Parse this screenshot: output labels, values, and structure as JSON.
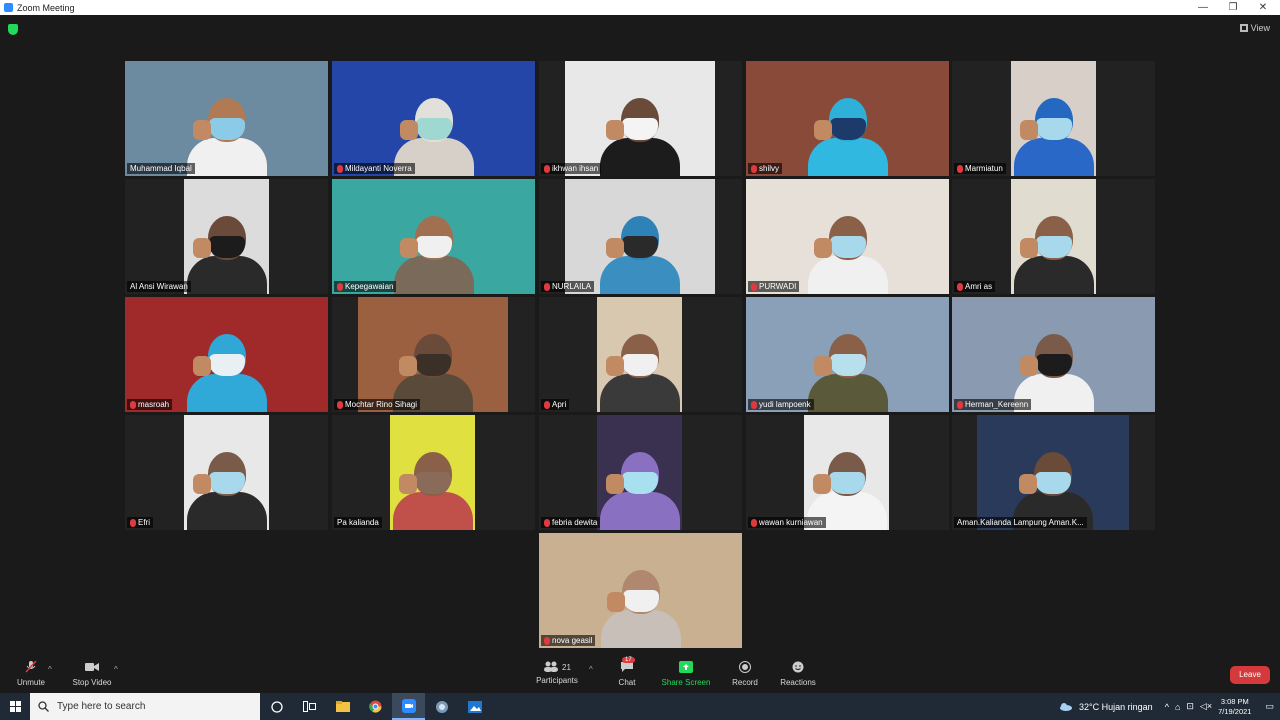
{
  "window": {
    "title": "Zoom Meeting",
    "controls": {
      "minimize": "—",
      "maximize": "❐",
      "close": "✕"
    }
  },
  "header": {
    "view_label": "View"
  },
  "participants": [
    {
      "name": "Muhammad Iqbal",
      "muted": false,
      "active": true,
      "bg": "#6c8aa0",
      "skin": "#b07a55",
      "mask": "#8ccbe8",
      "shirt": "#f0f0f0"
    },
    {
      "name": "Mildayanti Noverra",
      "muted": true,
      "active": false,
      "bg": "#2446a8",
      "skin": "#e2e0da",
      "mask": "#9fd8d0",
      "shirt": "#d6d0c8"
    },
    {
      "name": "ikhwan ihsan",
      "muted": true,
      "active": false,
      "bg": "#e8e8e8",
      "skin": "#6a4a38",
      "mask": "#f4f4f4",
      "shirt": "#1c1c1c"
    },
    {
      "name": "shilvy",
      "muted": true,
      "active": false,
      "bg": "#8a4a3a",
      "skin": "#2fb0d8",
      "mask": "#1d3b6a",
      "shirt": "#30b8e0"
    },
    {
      "name": "Marmiatun",
      "muted": true,
      "active": false,
      "bg": "#d8d0c8",
      "skin": "#2468c0",
      "mask": "#a8d8ec",
      "shirt": "#2a68c8"
    },
    {
      "name": "Al Ansi Wirawan",
      "muted": false,
      "active": false,
      "bg": "#dcdcdc",
      "skin": "#6a4a38",
      "mask": "#1c1c1c",
      "shirt": "#2a2a2a"
    },
    {
      "name": "Kepegawaian",
      "muted": true,
      "active": false,
      "bg": "#3aa8a0",
      "skin": "#a07050",
      "mask": "#f0f0f0",
      "shirt": "#7a6a5a"
    },
    {
      "name": "NURLAILA",
      "muted": true,
      "active": false,
      "bg": "#d8d8d8",
      "skin": "#2f82b8",
      "mask": "#2a2a2a",
      "shirt": "#3a8ec0"
    },
    {
      "name": "PURWADI",
      "muted": true,
      "active": false,
      "bg": "#e6e0d8",
      "skin": "#8a6048",
      "mask": "#a8d8ec",
      "shirt": "#f0f0f0"
    },
    {
      "name": "Amri as",
      "muted": true,
      "active": false,
      "bg": "#e0dcd0",
      "skin": "#8a6048",
      "mask": "#a8d8ec",
      "shirt": "#2a2a2a"
    },
    {
      "name": "masroah",
      "muted": true,
      "active": false,
      "bg": "#a02a2a",
      "skin": "#2fa8d8",
      "mask": "#e8f0f4",
      "shirt": "#30a8d8"
    },
    {
      "name": "Mochtar Rino Sihagi",
      "muted": true,
      "active": false,
      "bg": "#9a6040",
      "skin": "#6a4a38",
      "mask": "#3a3028",
      "shirt": "#5a4a3a"
    },
    {
      "name": "Apri",
      "muted": true,
      "active": false,
      "bg": "#d8c8b0",
      "skin": "#8a6048",
      "mask": "#f0f0f0",
      "shirt": "#3a3a3a"
    },
    {
      "name": "yudi lampoenk",
      "muted": true,
      "active": false,
      "bg": "#8aa0b8",
      "skin": "#8a6048",
      "mask": "#b8e0ec",
      "shirt": "#5a5a3a"
    },
    {
      "name": "Herman_Kereenn",
      "muted": true,
      "active": false,
      "bg": "#8a9ab0",
      "skin": "#7a5a48",
      "mask": "#1c1c1c",
      "shirt": "#f0f0f0"
    },
    {
      "name": "Efri",
      "muted": true,
      "active": false,
      "bg": "#e8e8e8",
      "skin": "#7a5a48",
      "mask": "#a8d8ec",
      "shirt": "#2a2a2a"
    },
    {
      "name": "Pa kalianda",
      "muted": false,
      "active": false,
      "bg": "#e0e040",
      "skin": "#8a6048",
      "mask": "#8a6a58",
      "shirt": "#c0504a"
    },
    {
      "name": "febria dewita",
      "muted": true,
      "active": false,
      "bg": "#3a3050",
      "skin": "#8a70c0",
      "mask": "#a8e0f0",
      "shirt": "#8a70c0"
    },
    {
      "name": "wawan kurniawan",
      "muted": true,
      "active": false,
      "bg": "#e8e8e8",
      "skin": "#7a5a48",
      "mask": "#a8d8ec",
      "shirt": "#f4f4f4"
    },
    {
      "name": "Aman.Kalianda Lampung Aman.K...",
      "muted": false,
      "active": false,
      "bg": "#2a3a5a",
      "skin": "#6a4a38",
      "mask": "#a8d8ec",
      "shirt": "#2a2a2a"
    },
    {
      "name": "nova geasil",
      "muted": true,
      "active": false,
      "bg": "#c8b090",
      "skin": "#b08870",
      "mask": "#f0f0f0",
      "shirt": "#c8c0b8"
    }
  ],
  "toolbar": {
    "unmute": "Unmute",
    "stop_video": "Stop Video",
    "participants_label": "Participants",
    "participants_count": "21",
    "chat_label": "Chat",
    "chat_badge": "17",
    "share_screen": "Share Screen",
    "record": "Record",
    "reactions": "Reactions",
    "leave": "Leave"
  },
  "taskbar": {
    "search_placeholder": "Type here to search",
    "weather": "32°C  Hujan ringan",
    "time": "3:08 PM",
    "date": "7/19/2021"
  },
  "colors": {
    "accent": "#2d8cff",
    "share_green": "#23d959",
    "leave_red": "#d4393c",
    "active_border": "#f2f23a"
  }
}
